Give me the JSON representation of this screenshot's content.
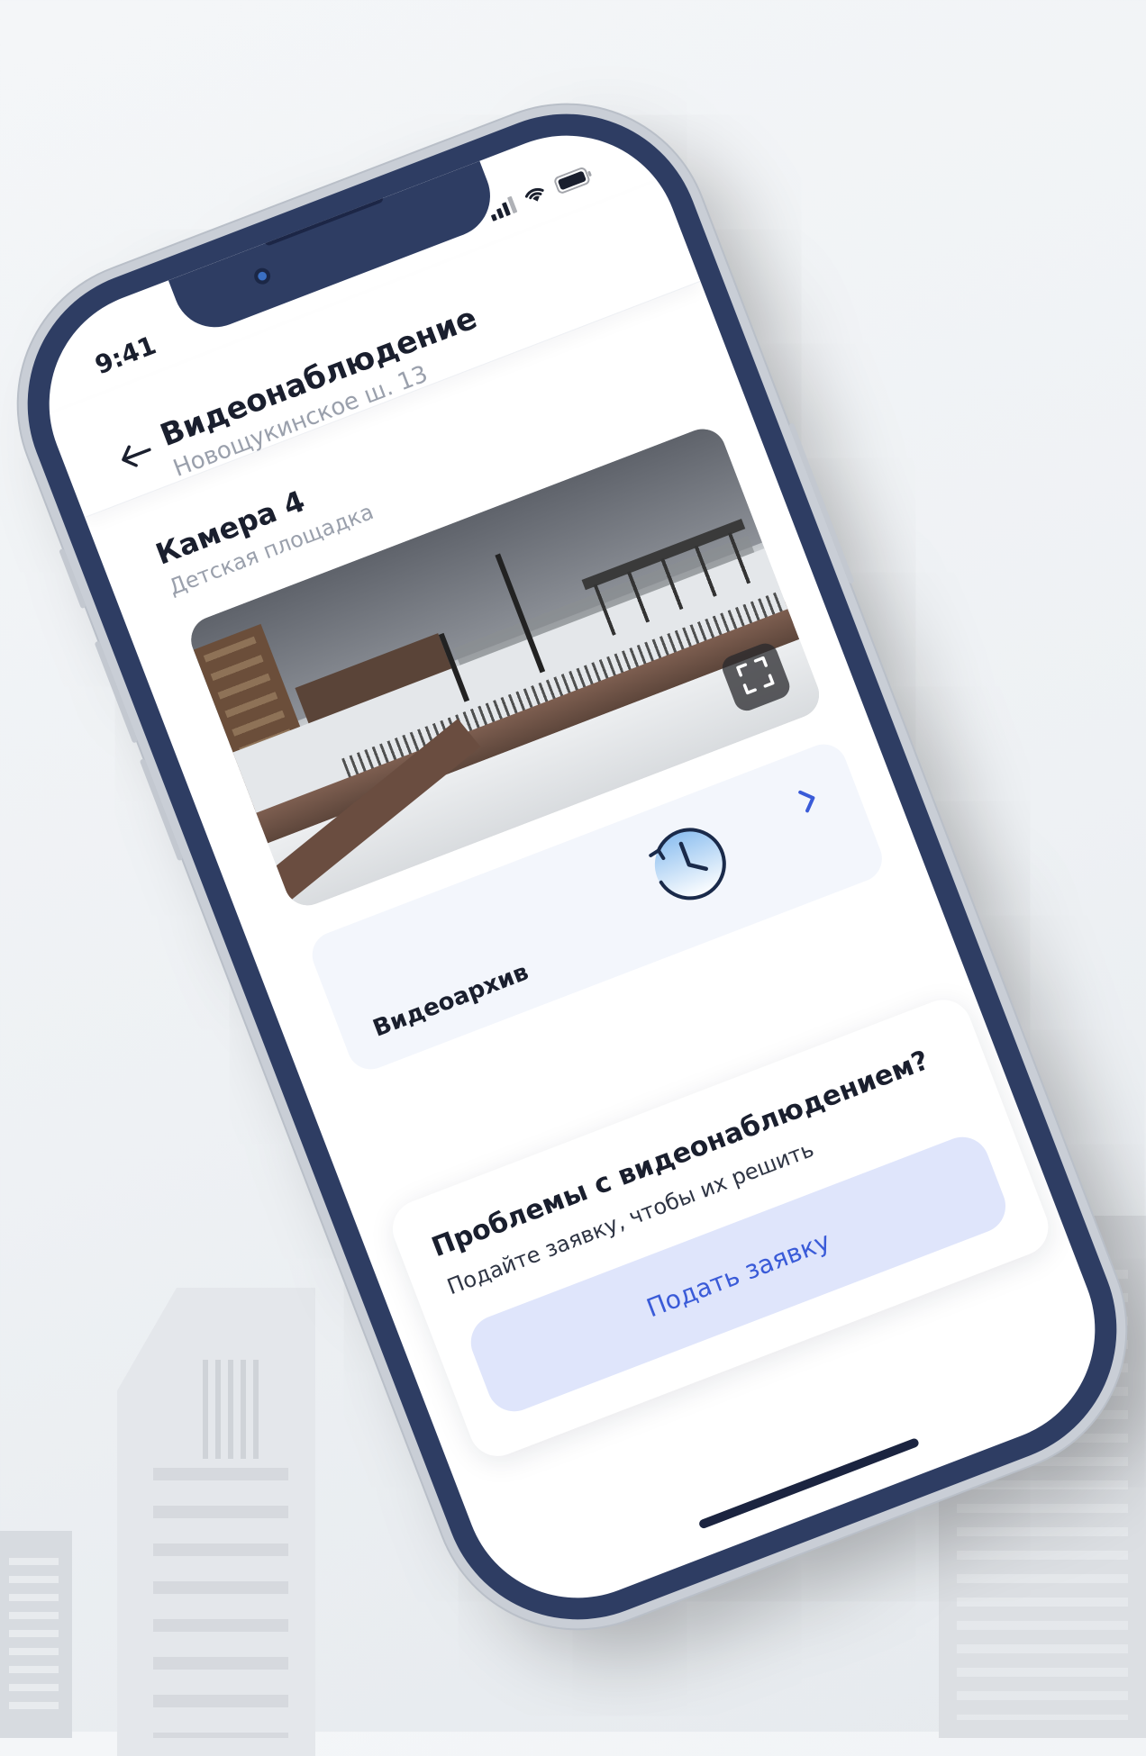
{
  "status_bar": {
    "time": "9:41"
  },
  "header": {
    "title": "Видеонаблюдение",
    "subtitle": "Новощукинское ш. 13"
  },
  "camera": {
    "title": "Камера 4",
    "location": "Детская площадка"
  },
  "archive": {
    "label": "Видеоархив"
  },
  "help": {
    "title": "Проблемы с видеонаблюдением?",
    "subtitle": "Подайте заявку, чтобы их решить",
    "button_label": "Подать заявку"
  },
  "colors": {
    "frame": "#2e3d63",
    "accent": "#3a5bd8",
    "button_bg": "#dfe5fb",
    "card_bg": "#f3f6fc"
  },
  "icons": [
    "back-arrow-icon",
    "signal-icon",
    "wifi-icon",
    "battery-icon",
    "fullscreen-icon",
    "clock-history-icon",
    "chevron-right-icon"
  ]
}
